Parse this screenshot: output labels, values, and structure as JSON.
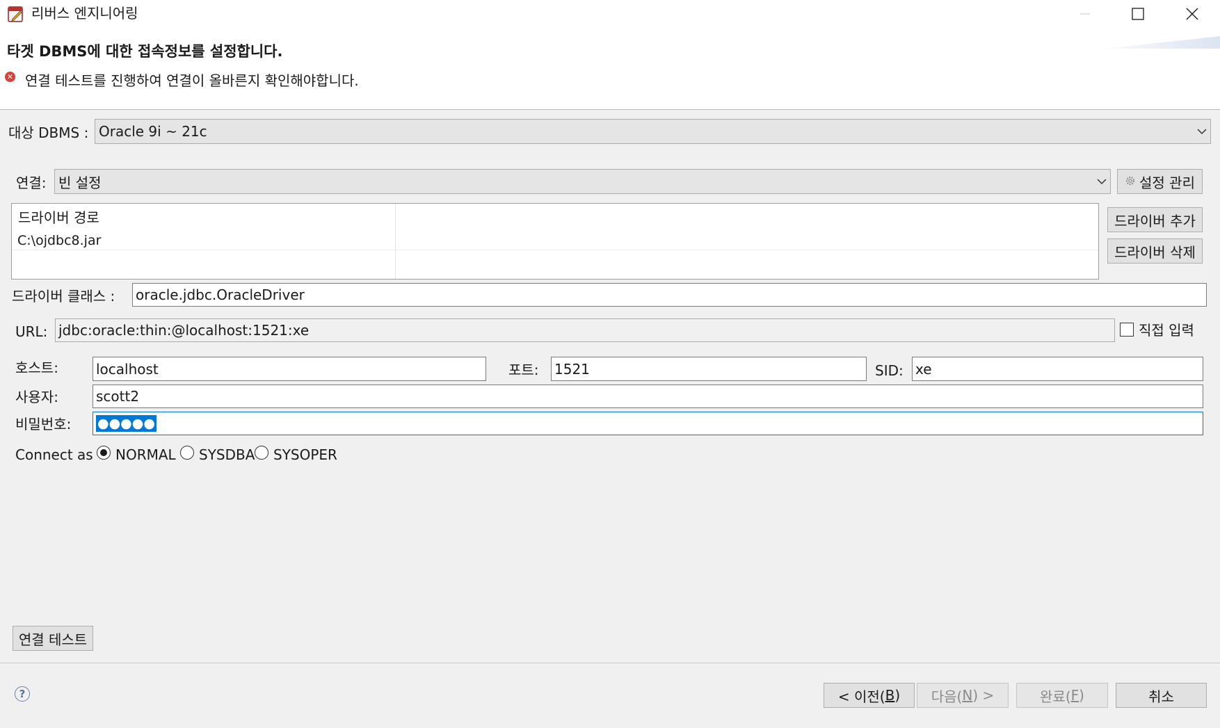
{
  "window": {
    "title": "리버스 엔지니어링"
  },
  "header": {
    "title": "타겟 DBMS에 대한 접속정보를 설정합니다.",
    "message": "연결 테스트를 진행하여 연결이 올바른지 확인해야합니다."
  },
  "dbms": {
    "label": "대상 DBMS :",
    "value": "Oracle 9i ~ 21c"
  },
  "connection": {
    "label": "연결:",
    "value": "빈 설정",
    "manage_label": "설정 관리"
  },
  "driver": {
    "path_header": "드라이버 경로",
    "paths": [
      "C:\\ojdbc8.jar"
    ],
    "add_label": "드라이버 추가",
    "delete_label": "드라이버 삭제",
    "class_label": "드라이버 클래스 :",
    "class_value": "oracle.jdbc.OracleDriver"
  },
  "url": {
    "label": "URL:",
    "value": "jdbc:oracle:thin:@localhost:1521:xe",
    "direct_label": "직접 입력"
  },
  "host": {
    "label": "호스트:",
    "value": "localhost"
  },
  "port": {
    "label": "포트:",
    "value": "1521"
  },
  "sid": {
    "label": "SID:",
    "value": "xe"
  },
  "user": {
    "label": "사용자:",
    "value": "scott2"
  },
  "password": {
    "label": "비밀번호:",
    "value": "●●●●●"
  },
  "connect_as": {
    "label": "Connect as",
    "options": [
      "NORMAL",
      "SYSDBA",
      "SYSOPER"
    ],
    "selected": "NORMAL"
  },
  "test_button": "연결 테스트",
  "footer": {
    "prev_pre": "< 이전(",
    "prev_key": "B",
    "prev_post": ")",
    "next_pre": "다음(",
    "next_key": "N",
    "next_post": ") >",
    "finish_pre": "완료(",
    "finish_key": "F",
    "finish_post": ")",
    "cancel": "취소"
  },
  "colors": {
    "panel": "#f0f0f0",
    "error": "#d9403a",
    "selection": "#0078d7"
  }
}
